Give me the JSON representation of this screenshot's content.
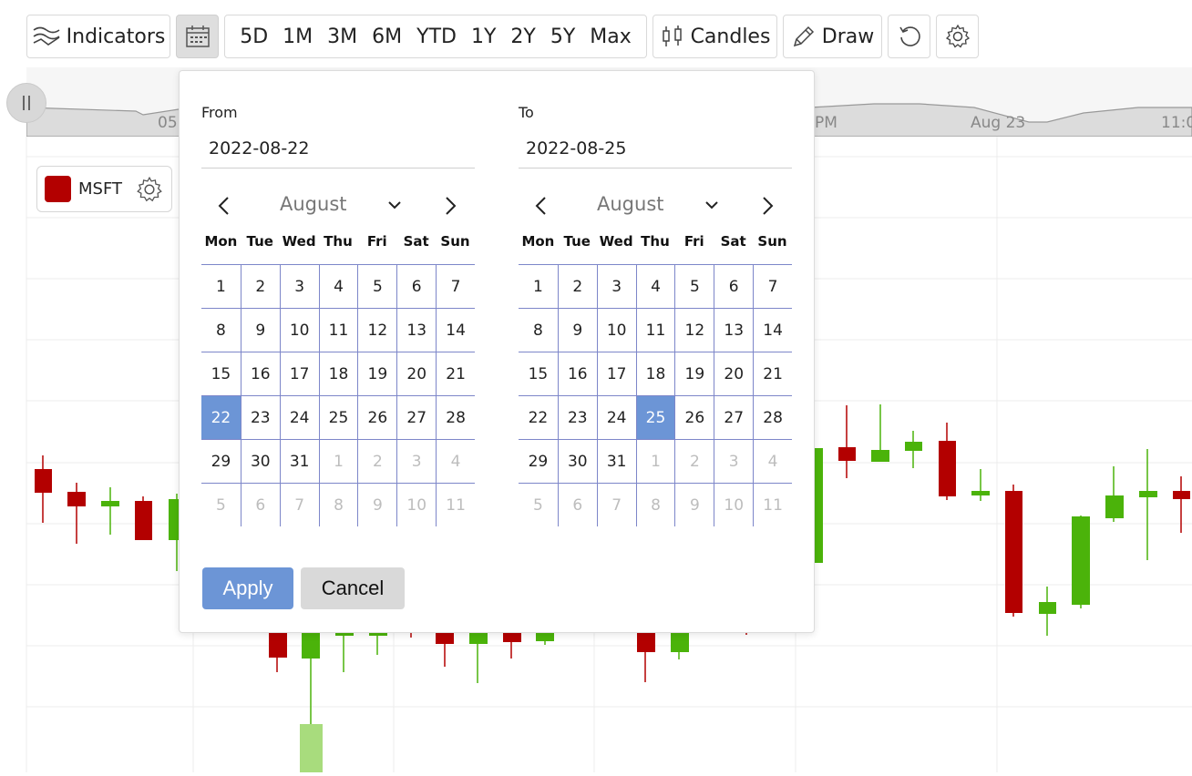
{
  "toolbar": {
    "indicators_label": "Indicators",
    "date_range_icon": "calendar-icon",
    "ranges": [
      "5D",
      "1M",
      "3M",
      "6M",
      "YTD",
      "1Y",
      "2Y",
      "5Y",
      "Max"
    ],
    "candles_label": "Candles",
    "draw_label": "Draw",
    "reset_icon": "reset-icon",
    "settings_icon": "gear-icon"
  },
  "navigator": {
    "labels": [
      "05",
      "PM",
      "Aug 23",
      "11:0"
    ]
  },
  "legend": {
    "symbol": "MSFT",
    "color": "#b30000"
  },
  "date_picker": {
    "from": {
      "label": "From",
      "value": "2022-08-22",
      "month": "August",
      "weekdays": [
        "Mon",
        "Tue",
        "Wed",
        "Thu",
        "Fri",
        "Sat",
        "Sun"
      ],
      "days": [
        {
          "d": "1",
          "m": false,
          "s": false
        },
        {
          "d": "2",
          "m": false,
          "s": false
        },
        {
          "d": "3",
          "m": false,
          "s": false
        },
        {
          "d": "4",
          "m": false,
          "s": false
        },
        {
          "d": "5",
          "m": false,
          "s": false
        },
        {
          "d": "6",
          "m": false,
          "s": false
        },
        {
          "d": "7",
          "m": false,
          "s": false
        },
        {
          "d": "8",
          "m": false,
          "s": false
        },
        {
          "d": "9",
          "m": false,
          "s": false
        },
        {
          "d": "10",
          "m": false,
          "s": false
        },
        {
          "d": "11",
          "m": false,
          "s": false
        },
        {
          "d": "12",
          "m": false,
          "s": false
        },
        {
          "d": "13",
          "m": false,
          "s": false
        },
        {
          "d": "14",
          "m": false,
          "s": false
        },
        {
          "d": "15",
          "m": false,
          "s": false
        },
        {
          "d": "16",
          "m": false,
          "s": false
        },
        {
          "d": "17",
          "m": false,
          "s": false
        },
        {
          "d": "18",
          "m": false,
          "s": false
        },
        {
          "d": "19",
          "m": false,
          "s": false
        },
        {
          "d": "20",
          "m": false,
          "s": false
        },
        {
          "d": "21",
          "m": false,
          "s": false
        },
        {
          "d": "22",
          "m": false,
          "s": true
        },
        {
          "d": "23",
          "m": false,
          "s": false
        },
        {
          "d": "24",
          "m": false,
          "s": false
        },
        {
          "d": "25",
          "m": false,
          "s": false
        },
        {
          "d": "26",
          "m": false,
          "s": false
        },
        {
          "d": "27",
          "m": false,
          "s": false
        },
        {
          "d": "28",
          "m": false,
          "s": false
        },
        {
          "d": "29",
          "m": false,
          "s": false
        },
        {
          "d": "30",
          "m": false,
          "s": false
        },
        {
          "d": "31",
          "m": false,
          "s": false
        },
        {
          "d": "1",
          "m": true,
          "s": false
        },
        {
          "d": "2",
          "m": true,
          "s": false
        },
        {
          "d": "3",
          "m": true,
          "s": false
        },
        {
          "d": "4",
          "m": true,
          "s": false
        },
        {
          "d": "5",
          "m": true,
          "s": false
        },
        {
          "d": "6",
          "m": true,
          "s": false
        },
        {
          "d": "7",
          "m": true,
          "s": false
        },
        {
          "d": "8",
          "m": true,
          "s": false
        },
        {
          "d": "9",
          "m": true,
          "s": false
        },
        {
          "d": "10",
          "m": true,
          "s": false
        },
        {
          "d": "11",
          "m": true,
          "s": false
        }
      ]
    },
    "to": {
      "label": "To",
      "value": "2022-08-25",
      "month": "August",
      "weekdays": [
        "Mon",
        "Tue",
        "Wed",
        "Thu",
        "Fri",
        "Sat",
        "Sun"
      ],
      "days": [
        {
          "d": "1",
          "m": false,
          "s": false
        },
        {
          "d": "2",
          "m": false,
          "s": false
        },
        {
          "d": "3",
          "m": false,
          "s": false
        },
        {
          "d": "4",
          "m": false,
          "s": false
        },
        {
          "d": "5",
          "m": false,
          "s": false
        },
        {
          "d": "6",
          "m": false,
          "s": false
        },
        {
          "d": "7",
          "m": false,
          "s": false
        },
        {
          "d": "8",
          "m": false,
          "s": false
        },
        {
          "d": "9",
          "m": false,
          "s": false
        },
        {
          "d": "10",
          "m": false,
          "s": false
        },
        {
          "d": "11",
          "m": false,
          "s": false
        },
        {
          "d": "12",
          "m": false,
          "s": false
        },
        {
          "d": "13",
          "m": false,
          "s": false
        },
        {
          "d": "14",
          "m": false,
          "s": false
        },
        {
          "d": "15",
          "m": false,
          "s": false
        },
        {
          "d": "16",
          "m": false,
          "s": false
        },
        {
          "d": "17",
          "m": false,
          "s": false
        },
        {
          "d": "18",
          "m": false,
          "s": false
        },
        {
          "d": "19",
          "m": false,
          "s": false
        },
        {
          "d": "20",
          "m": false,
          "s": false
        },
        {
          "d": "21",
          "m": false,
          "s": false
        },
        {
          "d": "22",
          "m": false,
          "s": false
        },
        {
          "d": "23",
          "m": false,
          "s": false
        },
        {
          "d": "24",
          "m": false,
          "s": false
        },
        {
          "d": "25",
          "m": false,
          "s": true
        },
        {
          "d": "26",
          "m": false,
          "s": false
        },
        {
          "d": "27",
          "m": false,
          "s": false
        },
        {
          "d": "28",
          "m": false,
          "s": false
        },
        {
          "d": "29",
          "m": false,
          "s": false
        },
        {
          "d": "30",
          "m": false,
          "s": false
        },
        {
          "d": "31",
          "m": false,
          "s": false
        },
        {
          "d": "1",
          "m": true,
          "s": false
        },
        {
          "d": "2",
          "m": true,
          "s": false
        },
        {
          "d": "3",
          "m": true,
          "s": false
        },
        {
          "d": "4",
          "m": true,
          "s": false
        },
        {
          "d": "5",
          "m": true,
          "s": false
        },
        {
          "d": "6",
          "m": true,
          "s": false
        },
        {
          "d": "7",
          "m": true,
          "s": false
        },
        {
          "d": "8",
          "m": true,
          "s": false
        },
        {
          "d": "9",
          "m": true,
          "s": false
        },
        {
          "d": "10",
          "m": true,
          "s": false
        },
        {
          "d": "11",
          "m": true,
          "s": false
        }
      ]
    },
    "apply_label": "Apply",
    "cancel_label": "Cancel"
  },
  "colors": {
    "up": "#4bb30a",
    "down": "#b30000",
    "accent": "#6c95d6"
  }
}
